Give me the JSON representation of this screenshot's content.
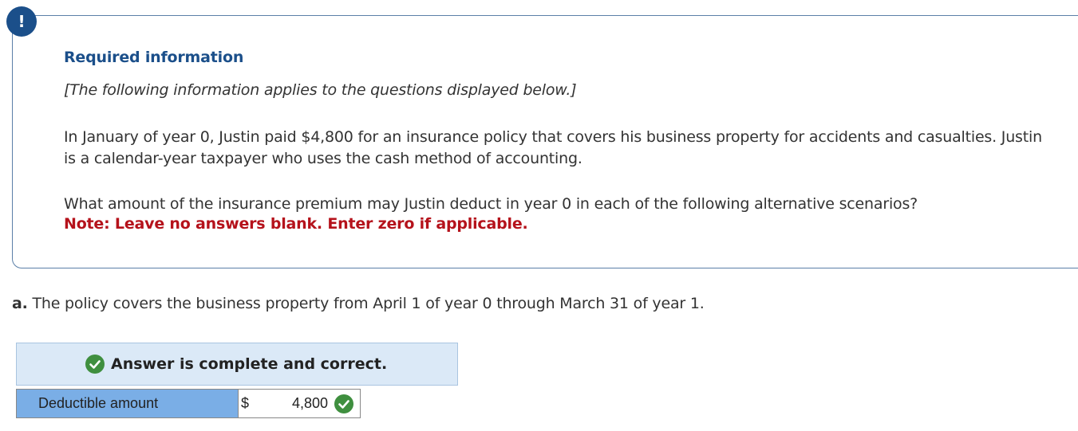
{
  "alert": {
    "symbol": "!",
    "icon": "exclamation-icon",
    "color": "#1b4f8a"
  },
  "info_panel": {
    "title": "Required information",
    "applies_note": "[The following information applies to the questions displayed below.]",
    "scenario": "In January of year 0, Justin paid $4,800 for an insurance policy that covers his business property for accidents and casualties. Justin is a calendar-year taxpayer who uses the cash method of accounting.",
    "question": "What amount of the insurance premium may Justin deduct in year 0 in each of the following alternative scenarios?",
    "note": "Note: Leave no answers blank. Enter zero if applicable.",
    "title_color": "#1b4f8a",
    "note_color": "#b5121b"
  },
  "part_a": {
    "letter": "a.",
    "text": "The policy covers the business property from April 1 of year 0 through March 31 of year 1."
  },
  "answer": {
    "status": "Answer is complete and correct.",
    "status_icon": "check-circle-icon",
    "banner_color": "#dbe9f7",
    "row": {
      "label": "Deductible amount",
      "currency": "$",
      "value": "4,800",
      "result_icon": "check-circle-icon",
      "label_bg": "#7aaee6"
    }
  }
}
